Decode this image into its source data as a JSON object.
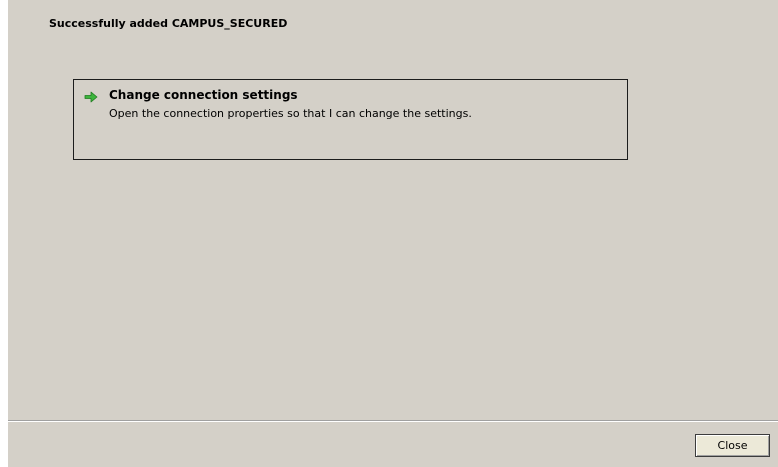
{
  "dialog": {
    "heading": "Successfully added CAMPUS_SECURED",
    "command_link": {
      "icon": "green-arrow-right-icon",
      "title": "Change connection settings",
      "description": "Open the connection properties so that I can change the settings."
    },
    "footer": {
      "close_label": "Close"
    }
  },
  "colors": {
    "dialog_background": "#d4d0c8",
    "arrow_green": "#3cb43c"
  }
}
